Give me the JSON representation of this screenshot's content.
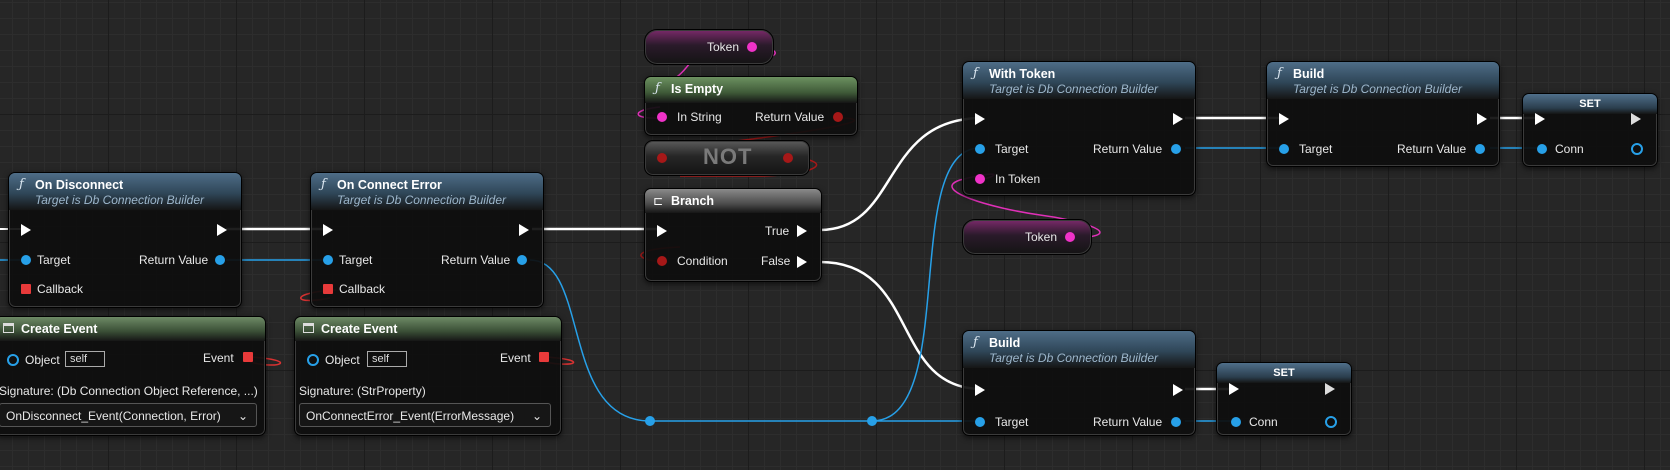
{
  "graph": {
    "on_disconnect": {
      "title": "On Disconnect",
      "subtitle": "Target is Db Connection Builder",
      "target": "Target",
      "return_value": "Return Value",
      "callback": "Callback"
    },
    "on_connect_error": {
      "title": "On Connect Error",
      "subtitle": "Target is Db Connection Builder",
      "target": "Target",
      "return_value": "Return Value",
      "callback": "Callback"
    },
    "create_event_1": {
      "title": "Create Event",
      "object": "Object",
      "self": "self",
      "event": "Event",
      "signature": "Signature: (Db Connection Object Reference, ...)",
      "selected": "OnDisconnect_Event(Connection, Error)"
    },
    "create_event_2": {
      "title": "Create Event",
      "object": "Object",
      "self": "self",
      "event": "Event",
      "signature": "Signature: (StrProperty)",
      "selected": "OnConnectError_Event(ErrorMessage)"
    },
    "token_top": {
      "label": "Token"
    },
    "is_empty": {
      "title": "Is Empty",
      "in_string": "In String",
      "return_value": "Return Value"
    },
    "not_node": {
      "label": "NOT"
    },
    "branch": {
      "title": "Branch",
      "true_label": "True",
      "condition": "Condition",
      "false_label": "False"
    },
    "with_token": {
      "title": "With Token",
      "subtitle": "Target is Db Connection Builder",
      "target": "Target",
      "return_value": "Return Value",
      "in_token": "In Token"
    },
    "token_mid": {
      "label": "Token"
    },
    "build_top": {
      "title": "Build",
      "subtitle": "Target is Db Connection Builder",
      "target": "Target",
      "return_value": "Return Value"
    },
    "set_top": {
      "title": "SET",
      "conn": "Conn"
    },
    "build_bottom": {
      "title": "Build",
      "subtitle": "Target is Db Connection Builder",
      "target": "Target",
      "return_value": "Return Value"
    },
    "set_bottom": {
      "title": "SET",
      "conn": "Conn"
    }
  },
  "icons": {
    "function": "function-icon",
    "event": "event-icon",
    "branch": "branch-icon"
  },
  "colors": {
    "exec_wire": "#ffffff",
    "object_wire": "#27a0e8",
    "string_wire": "#f032c8",
    "bool_wire": "#a61818",
    "delegate_pin": "#e83a3a"
  }
}
